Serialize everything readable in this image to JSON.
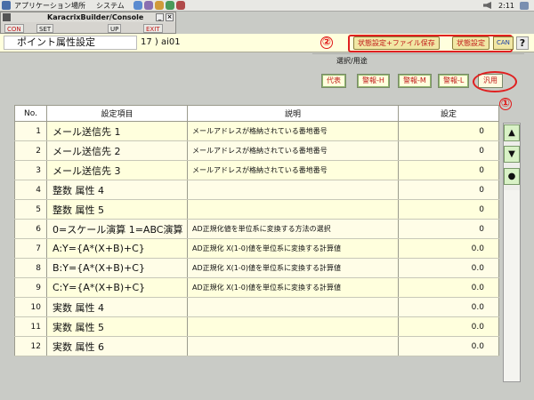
{
  "system_panel": {
    "menus": [
      "アプリケーション",
      "場所",
      "システム"
    ],
    "clock": "2:11"
  },
  "console": {
    "title": "KaracrixBuilder/Console",
    "toolbar": [
      "CON",
      "SET",
      "UP",
      "EXIT"
    ]
  },
  "header": {
    "title": "ポイント属性設定",
    "point_id": "17 ) ai01",
    "save_file_button": "状態設定+ファイル保存",
    "state_setting_button": "状態設定",
    "cancel_button": "CAN",
    "help_button": "?",
    "marker_2": "②",
    "marker_1": "①"
  },
  "purpose": {
    "label": "選択/用途",
    "buttons": [
      "代表",
      "警報-H",
      "警報-M",
      "警報-L",
      "汎用"
    ],
    "active": "汎用"
  },
  "table": {
    "headers": [
      "No.",
      "設定項目",
      "説明",
      "設定"
    ],
    "rows": [
      {
        "no": "1",
        "item": "メール送信先 1",
        "desc": "メールアドレスが格納されている番地番号",
        "value": "0"
      },
      {
        "no": "2",
        "item": "メール送信先 2",
        "desc": "メールアドレスが格納されている番地番号",
        "value": "0"
      },
      {
        "no": "3",
        "item": "メール送信先 3",
        "desc": "メールアドレスが格納されている番地番号",
        "value": "0"
      },
      {
        "no": "4",
        "item": "整数 属性 4",
        "desc": "",
        "value": "0"
      },
      {
        "no": "5",
        "item": "整数 属性 5",
        "desc": "",
        "value": "0"
      },
      {
        "no": "6",
        "item": "0=スケール演算 1=ABC演算",
        "desc": "AD正規化値を単位系に変換する方法の選択",
        "value": "0"
      },
      {
        "no": "7",
        "item": "A:Y={A*(X+B)+C}",
        "desc": "AD正規化 X(1-0)値を単位系に変換する計算値",
        "value": "0.0"
      },
      {
        "no": "8",
        "item": "B:Y={A*(X+B)+C}",
        "desc": "AD正規化 X(1-0)値を単位系に変換する計算値",
        "value": "0.0"
      },
      {
        "no": "9",
        "item": "C:Y={A*(X+B)+C}",
        "desc": "AD正規化 X(1-0)値を単位系に変換する計算値",
        "value": "0.0"
      },
      {
        "no": "10",
        "item": "実数 属性 4",
        "desc": "",
        "value": "0.0"
      },
      {
        "no": "11",
        "item": "実数 属性 5",
        "desc": "",
        "value": "0.0"
      },
      {
        "no": "12",
        "item": "実数 属性 6",
        "desc": "",
        "value": "0.0"
      }
    ]
  },
  "scroll": {
    "up_icon": "▲",
    "down_icon": "▼",
    "dot_icon": "●"
  }
}
